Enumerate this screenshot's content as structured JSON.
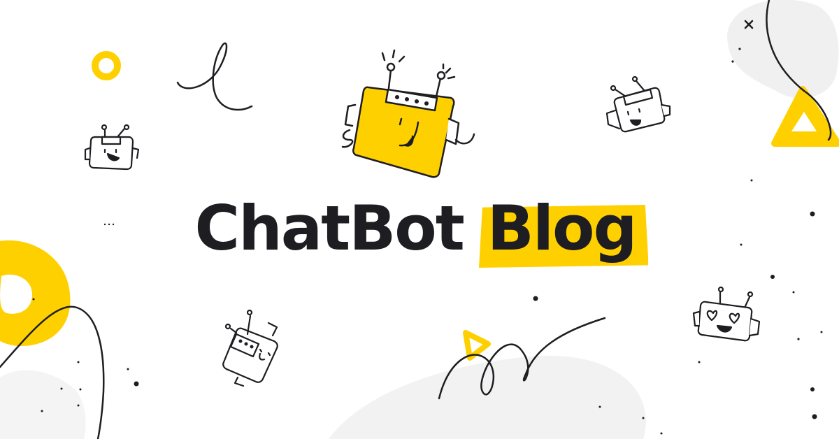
{
  "banner": {
    "title_primary": "ChatBot",
    "title_highlight": "Blog"
  },
  "colors": {
    "accent": "#FFD000",
    "ink": "#1e1e22",
    "soft_gray": "#f0f0f0",
    "background": "#ffffff"
  },
  "illustrations": [
    "robot-yellow-main-icon",
    "robot-small-left-icon",
    "robot-small-top-right-icon",
    "robot-heart-eyes-icon",
    "robot-tilted-icon",
    "play-triangle-icon"
  ]
}
